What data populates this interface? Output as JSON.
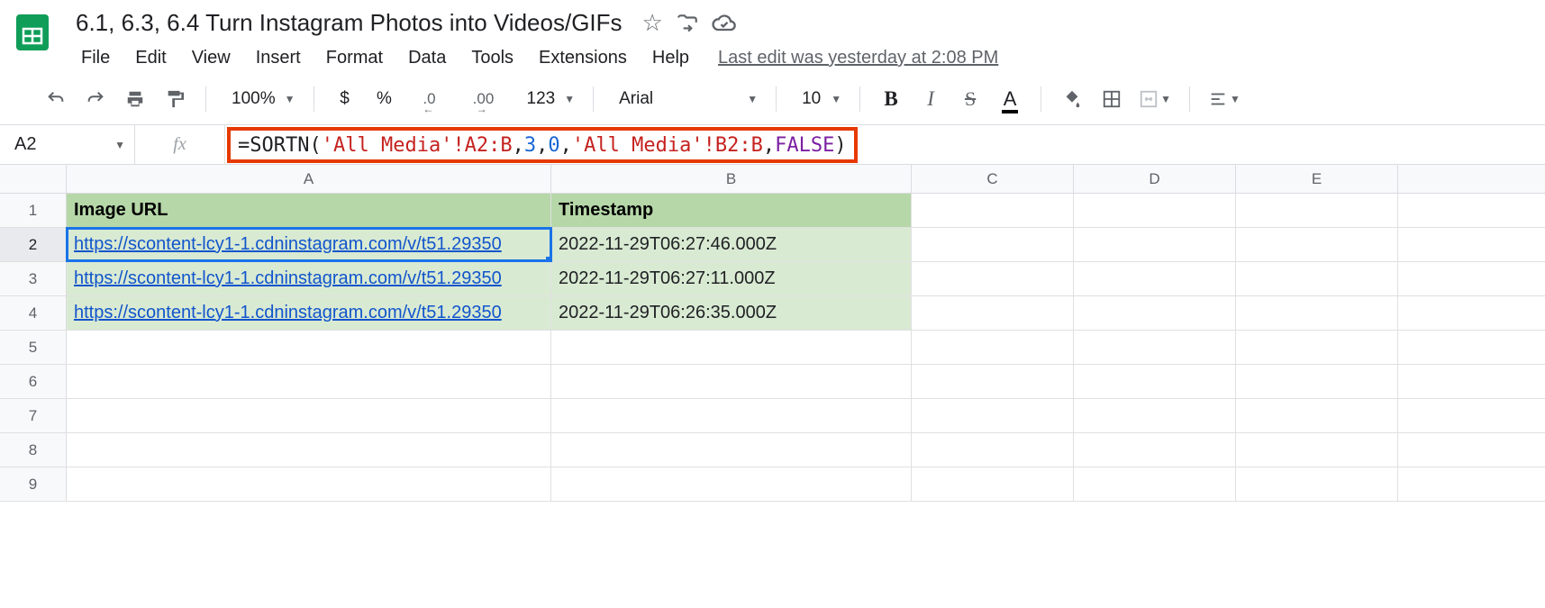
{
  "doc": {
    "title": "6.1, 6.3, 6.4 Turn Instagram Photos into Videos/GIFs",
    "last_edit": "Last edit was yesterday at 2:08 PM"
  },
  "menu": {
    "file": "File",
    "edit": "Edit",
    "view": "View",
    "insert": "Insert",
    "format": "Format",
    "data": "Data",
    "tools": "Tools",
    "extensions": "Extensions",
    "help": "Help"
  },
  "toolbar": {
    "zoom": "100%",
    "currency": "$",
    "percent": "%",
    "dec_dec": ".0",
    "inc_dec": ".00",
    "more_formats": "123",
    "font": "Arial",
    "font_size": "10",
    "bold": "B",
    "italic": "I",
    "strike": "S",
    "text_color": "A"
  },
  "formula_bar": {
    "cell_ref": "A2",
    "fx": "fx",
    "eq": "=",
    "fn": "SORTN",
    "open": "(",
    "arg1_sheet": "'All Media'",
    "arg1_range": "!A2:B",
    "c1": ",",
    "arg2": "3",
    "c2": ",",
    "arg3": "0",
    "c3": ",",
    "arg4_sheet": "'All Media'",
    "arg4_range": "!B2:B",
    "c4": ",",
    "arg5": "FALSE",
    "close": ")"
  },
  "columns": {
    "a": "A",
    "b": "B",
    "c": "C",
    "d": "D",
    "e": "E"
  },
  "row_nums": [
    "1",
    "2",
    "3",
    "4",
    "5",
    "6",
    "7",
    "8",
    "9"
  ],
  "headers": {
    "a": "Image URL",
    "b": "Timestamp"
  },
  "data": [
    {
      "url": "https://scontent-lcy1-1.cdninstagram.com/v/t51.29350",
      "ts": "2022-11-29T06:27:46.000Z"
    },
    {
      "url": "https://scontent-lcy1-1.cdninstagram.com/v/t51.29350",
      "ts": "2022-11-29T06:27:11.000Z"
    },
    {
      "url": "https://scontent-lcy1-1.cdninstagram.com/v/t51.29350",
      "ts": "2022-11-29T06:26:35.000Z"
    }
  ]
}
